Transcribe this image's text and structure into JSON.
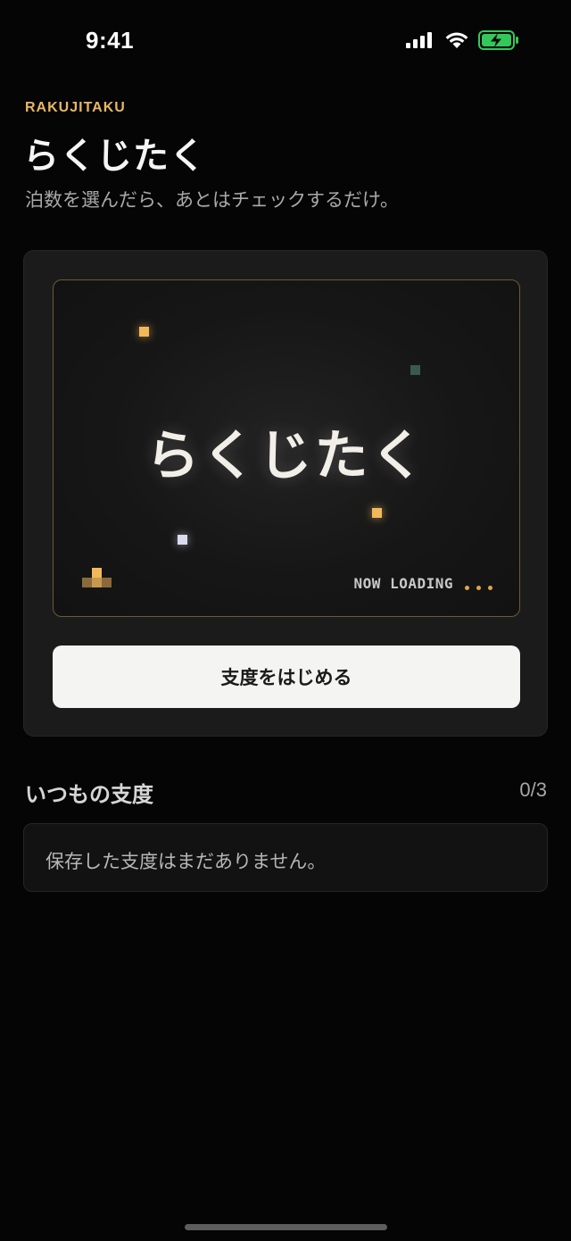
{
  "status_bar": {
    "time": "9:41",
    "icons": [
      "signal-icon",
      "wifi-icon",
      "battery-charging-icon"
    ],
    "battery_color": "#34c759"
  },
  "header": {
    "brand": "RAKUJITAKU",
    "title": "らくじたく",
    "subtitle": "泊数を選んだら、あとはチェックするだけ。"
  },
  "hero": {
    "loading_title": "らくじたく",
    "loading_text": "NOW LOADING",
    "start_button_label": "支度をはじめる",
    "accent_color": "#e8b764"
  },
  "saved": {
    "title": "いつもの支度",
    "count": "0/3",
    "empty_message": "保存した支度はまだありません。"
  }
}
